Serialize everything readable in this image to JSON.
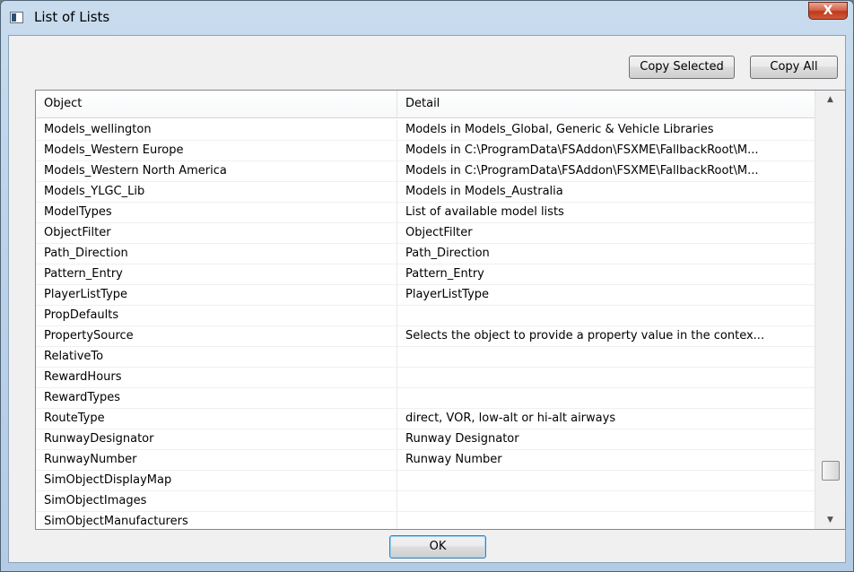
{
  "window": {
    "title": "List of Lists",
    "close_label": "X"
  },
  "toolbar": {
    "copy_selected_label": "Copy Selected",
    "copy_all_label": "Copy All"
  },
  "table": {
    "columns": [
      "Object",
      "Detail"
    ],
    "rows": [
      {
        "object": "Models_wellington",
        "detail": "Models in Models_Global, Generic & Vehicle Libraries"
      },
      {
        "object": "Models_Western Europe",
        "detail": "Models in C:\\ProgramData\\FSAddon\\FSXME\\FallbackRoot\\M..."
      },
      {
        "object": "Models_Western North America",
        "detail": "Models in C:\\ProgramData\\FSAddon\\FSXME\\FallbackRoot\\M..."
      },
      {
        "object": "Models_YLGC_Lib",
        "detail": "Models in Models_Australia"
      },
      {
        "object": "ModelTypes",
        "detail": "List of available model lists"
      },
      {
        "object": "ObjectFilter",
        "detail": "ObjectFilter"
      },
      {
        "object": "Path_Direction",
        "detail": "Path_Direction"
      },
      {
        "object": "Pattern_Entry",
        "detail": "Pattern_Entry"
      },
      {
        "object": "PlayerListType",
        "detail": "PlayerListType"
      },
      {
        "object": "PropDefaults",
        "detail": ""
      },
      {
        "object": "PropertySource",
        "detail": "Selects the object to provide a property value in the contex..."
      },
      {
        "object": "RelativeTo",
        "detail": ""
      },
      {
        "object": "RewardHours",
        "detail": ""
      },
      {
        "object": "RewardTypes",
        "detail": ""
      },
      {
        "object": "RouteType",
        "detail": "direct, VOR, low-alt or hi-alt airways"
      },
      {
        "object": "RunwayDesignator",
        "detail": "Runway Designator"
      },
      {
        "object": "RunwayNumber",
        "detail": "Runway Number"
      },
      {
        "object": "SimObjectDisplayMap",
        "detail": ""
      },
      {
        "object": "SimObjectImages",
        "detail": ""
      },
      {
        "object": "SimObjectManufacturers",
        "detail": ""
      }
    ]
  },
  "scrollbar": {
    "up_icon": "chevron-up-icon",
    "down_icon": "chevron-down-icon"
  },
  "footer": {
    "ok_label": "OK"
  }
}
